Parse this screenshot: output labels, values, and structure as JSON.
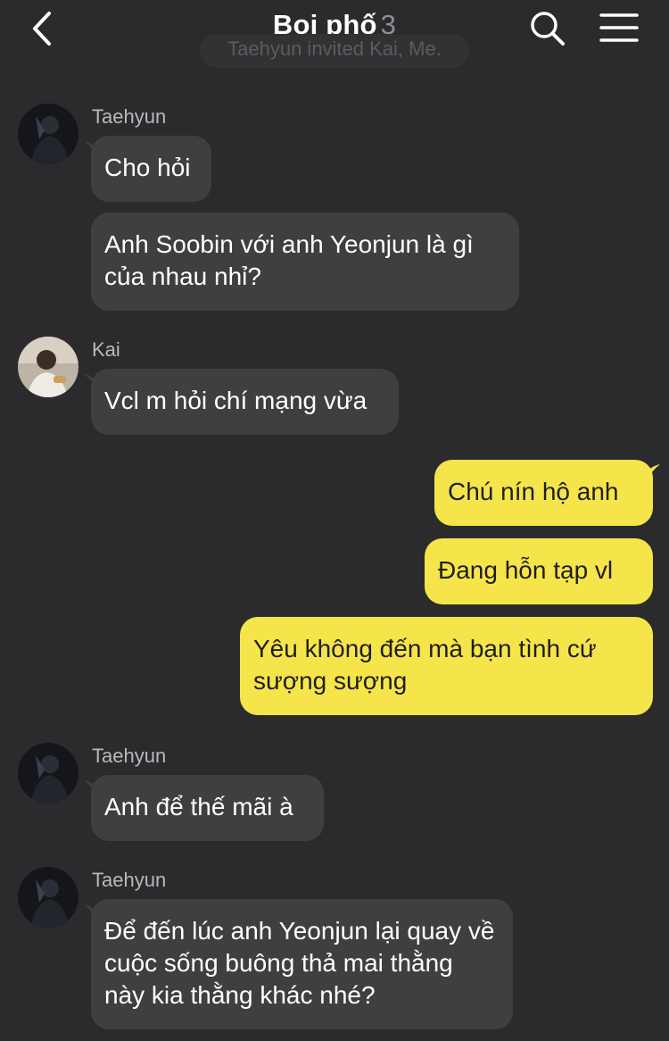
{
  "header": {
    "title": "Boi phố",
    "member_count": "3"
  },
  "system_message": "Taehyun invited Kai, Me.",
  "messages": [
    {
      "sender": "Taehyun",
      "bubbles": [
        "Cho hỏi",
        "Anh Soobin với anh Yeonjun là gì của nhau nhỉ?"
      ]
    },
    {
      "sender": "Kai",
      "bubbles": [
        "Vcl m hỏi chí mạng vừa"
      ]
    },
    {
      "sender": "Me",
      "bubbles": [
        "Chú nín hộ anh",
        "Đang hỗn tạp vl",
        "Yêu không đến mà bạn tình cứ sượng sượng"
      ]
    },
    {
      "sender": "Taehyun",
      "bubbles": [
        "Anh để thế mãi à"
      ]
    },
    {
      "sender": "Taehyun",
      "bubbles": [
        "Để đến lúc anh Yeonjun lại quay về cuộc sống buông thả mai thằng này kia thằng khác nhé?"
      ]
    }
  ],
  "colors": {
    "background": "#2b2b2d",
    "incoming_bubble": "#3f3f42",
    "outgoing_bubble": "#f6e54a"
  }
}
